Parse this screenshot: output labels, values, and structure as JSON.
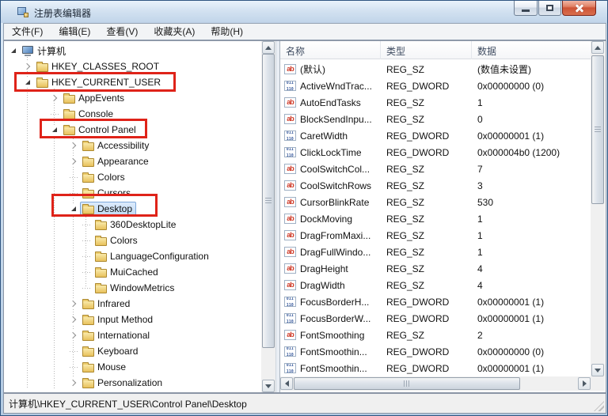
{
  "window": {
    "title": "注册表编辑器",
    "status_path": "计算机\\HKEY_CURRENT_USER\\Control Panel\\Desktop"
  },
  "menu": {
    "items": [
      "文件(F)",
      "编辑(E)",
      "查看(V)",
      "收藏夹(A)",
      "帮助(H)"
    ]
  },
  "tree": {
    "items": [
      {
        "label": "计算机",
        "level": 0,
        "expander": "expanded",
        "icon": "computer"
      },
      {
        "label": "HKEY_CLASSES_ROOT",
        "level": 1,
        "expander": "collapsed",
        "icon": "folder"
      },
      {
        "label": "HKEY_CURRENT_USER",
        "level": 1,
        "expander": "expanded",
        "icon": "folder",
        "red_box": true
      },
      {
        "label": "AppEvents",
        "level": 2,
        "expander": "collapsed",
        "icon": "folder"
      },
      {
        "label": "Console",
        "level": 2,
        "expander": "none",
        "icon": "folder"
      },
      {
        "label": "Control Panel",
        "level": 2,
        "expander": "expanded",
        "icon": "folder",
        "red_box": true
      },
      {
        "label": "Accessibility",
        "level": 3,
        "expander": "collapsed",
        "icon": "folder"
      },
      {
        "label": "Appearance",
        "level": 3,
        "expander": "collapsed",
        "icon": "folder"
      },
      {
        "label": "Colors",
        "level": 3,
        "expander": "none",
        "icon": "folder"
      },
      {
        "label": "Cursors",
        "level": 3,
        "expander": "none",
        "icon": "folder"
      },
      {
        "label": "Desktop",
        "level": 3,
        "expander": "expanded",
        "icon": "folder",
        "selected": true,
        "red_box": true
      },
      {
        "label": "360DesktopLite",
        "level": 4,
        "expander": "none",
        "icon": "folder"
      },
      {
        "label": "Colors",
        "level": 4,
        "expander": "none",
        "icon": "folder"
      },
      {
        "label": "LanguageConfiguration",
        "level": 4,
        "expander": "none",
        "icon": "folder"
      },
      {
        "label": "MuiCached",
        "level": 4,
        "expander": "none",
        "icon": "folder"
      },
      {
        "label": "WindowMetrics",
        "level": 4,
        "expander": "none",
        "icon": "folder"
      },
      {
        "label": "Infrared",
        "level": 3,
        "expander": "collapsed",
        "icon": "folder"
      },
      {
        "label": "Input Method",
        "level": 3,
        "expander": "collapsed",
        "icon": "folder"
      },
      {
        "label": "International",
        "level": 3,
        "expander": "collapsed",
        "icon": "folder"
      },
      {
        "label": "Keyboard",
        "level": 3,
        "expander": "none",
        "icon": "folder"
      },
      {
        "label": "Mouse",
        "level": 3,
        "expander": "none",
        "icon": "folder"
      },
      {
        "label": "Personalization",
        "level": 3,
        "expander": "collapsed",
        "icon": "folder"
      }
    ]
  },
  "list": {
    "columns": [
      "名称",
      "类型",
      "数据"
    ],
    "rows": [
      {
        "name": "(默认)",
        "type": "REG_SZ",
        "data": "(数值未设置)"
      },
      {
        "name": "ActiveWndTrac...",
        "type": "REG_DWORD",
        "data": "0x00000000 (0)"
      },
      {
        "name": "AutoEndTasks",
        "type": "REG_SZ",
        "data": "1"
      },
      {
        "name": "BlockSendInpu...",
        "type": "REG_SZ",
        "data": "0"
      },
      {
        "name": "CaretWidth",
        "type": "REG_DWORD",
        "data": "0x00000001 (1)"
      },
      {
        "name": "ClickLockTime",
        "type": "REG_DWORD",
        "data": "0x000004b0 (1200)"
      },
      {
        "name": "CoolSwitchCol...",
        "type": "REG_SZ",
        "data": "7"
      },
      {
        "name": "CoolSwitchRows",
        "type": "REG_SZ",
        "data": "3"
      },
      {
        "name": "CursorBlinkRate",
        "type": "REG_SZ",
        "data": "530"
      },
      {
        "name": "DockMoving",
        "type": "REG_SZ",
        "data": "1"
      },
      {
        "name": "DragFromMaxi...",
        "type": "REG_SZ",
        "data": "1"
      },
      {
        "name": "DragFullWindo...",
        "type": "REG_SZ",
        "data": "1"
      },
      {
        "name": "DragHeight",
        "type": "REG_SZ",
        "data": "4"
      },
      {
        "name": "DragWidth",
        "type": "REG_SZ",
        "data": "4"
      },
      {
        "name": "FocusBorderH...",
        "type": "REG_DWORD",
        "data": "0x00000001 (1)"
      },
      {
        "name": "FocusBorderW...",
        "type": "REG_DWORD",
        "data": "0x00000001 (1)"
      },
      {
        "name": "FontSmoothing",
        "type": "REG_SZ",
        "data": "2"
      },
      {
        "name": "FontSmoothin...",
        "type": "REG_DWORD",
        "data": "0x00000000 (0)"
      },
      {
        "name": "FontSmoothin...",
        "type": "REG_DWORD",
        "data": "0x00000001 (1)"
      }
    ]
  },
  "colors": {
    "annotation_red": "#df2319",
    "selection_border": "#7da7d9",
    "close_button_red": "#cd5436",
    "folder_yellow": "#e8c15c"
  }
}
